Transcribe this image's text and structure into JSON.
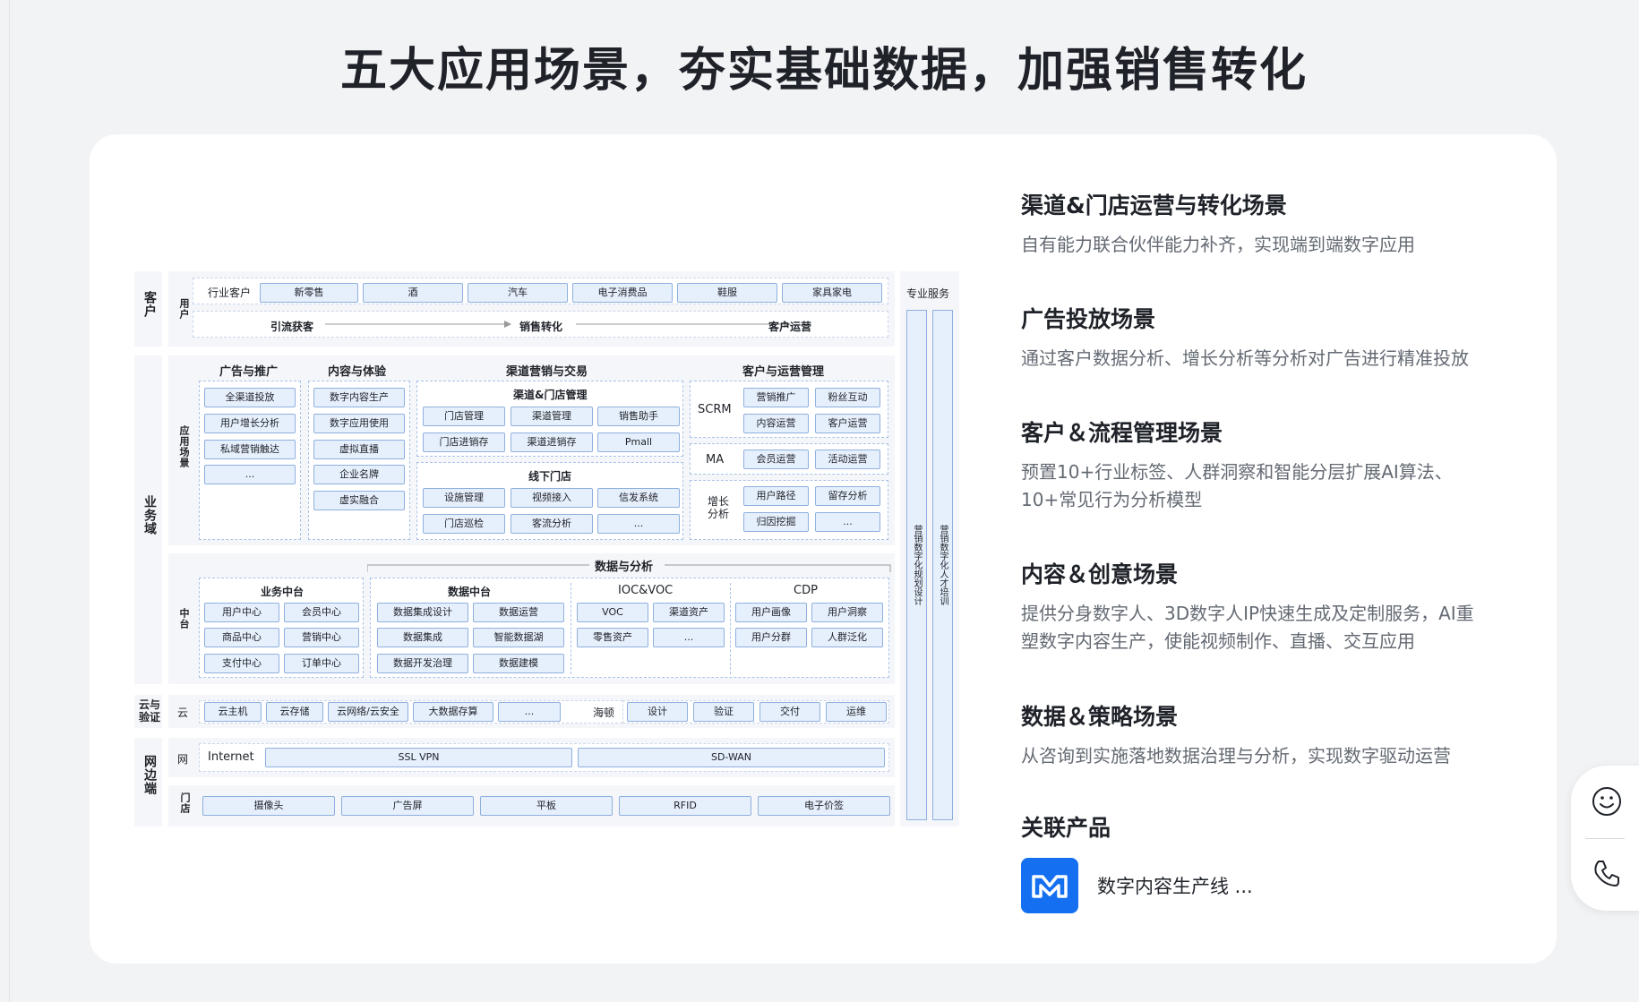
{
  "page": {
    "title": "五大应用场景，夯实基础数据，加强销售转化"
  },
  "diagram": {
    "customer_label": "客户",
    "user_label": "用户",
    "industry_label": "行业客户",
    "industries": [
      "新零售",
      "酒",
      "汽车",
      "电子消费品",
      "鞋服",
      "家具家电"
    ],
    "flow": [
      "引流获客",
      "销售转化",
      "客户运营"
    ],
    "business_label": "业务域",
    "app_label": "应用场景",
    "ad": {
      "title": "广告与推广",
      "items": [
        "全渠道投放",
        "用户增长分析",
        "私域营销触达",
        "..."
      ]
    },
    "content": {
      "title": "内容与体验",
      "items": [
        "数字内容生产",
        "数字应用使用",
        "虚拟直播",
        "企业名牌",
        "虚实融合"
      ]
    },
    "channel": {
      "title": "渠道营销与交易",
      "store_mgmt": {
        "title": "渠道&门店管理",
        "items": [
          "门店管理",
          "渠道管理",
          "销售助手",
          "门店进销存",
          "渠道进销存",
          "Pmall"
        ]
      },
      "offline": {
        "title": "线下门店",
        "items": [
          "设施管理",
          "视频接入",
          "信发系统",
          "门店巡检",
          "客流分析",
          "..."
        ]
      }
    },
    "ops": {
      "title": "客户与运营管理",
      "scrm_label": "SCRM",
      "scrm_items": [
        "营销推广",
        "粉丝互动",
        "内容运营",
        "客户运营"
      ],
      "ma_label": "MA",
      "ma_items": [
        "会员运营",
        "活动运营"
      ],
      "growth_label": "增长分析",
      "growth_items": [
        "用户路径",
        "留存分析",
        "归因挖掘",
        "..."
      ]
    },
    "data_analysis_title": "数据与分析",
    "middle_label": "中台",
    "biz_mid": {
      "title": "业务中台",
      "items": [
        "用户中心",
        "会员中心",
        "商品中心",
        "营销中心",
        "支付中心",
        "订单中心"
      ]
    },
    "data_mid": {
      "title": "数据中台",
      "items": [
        "数据集成设计",
        "数据运营",
        "数据集成",
        "智能数据湖",
        "数据开发治理",
        "数据建模"
      ]
    },
    "ioc": {
      "title": "IOC&VOC",
      "items": [
        "VOC",
        "渠道资产",
        "零售资产",
        "..."
      ]
    },
    "cdp": {
      "title": "CDP",
      "items": [
        "用户画像",
        "用户洞察",
        "用户分群",
        "人群泛化"
      ]
    },
    "cloud_label": "云与验证",
    "cloud_row_label": "云",
    "cloud_items": [
      "云主机",
      "云存储",
      "云网络/云安全",
      "大数据存算",
      "..."
    ],
    "haidun_label": "海顿",
    "haidun_items": [
      "设计",
      "验证",
      "交付",
      "运维"
    ],
    "edge_label": "网边端",
    "net_label": "网",
    "net_items": [
      "Internet",
      "SSL VPN",
      "SD-WAN"
    ],
    "store_label": "门店",
    "store_items": [
      "摄像头",
      "广告屏",
      "平板",
      "RFID",
      "电子价签"
    ],
    "pro_service": {
      "title": "专业服务",
      "bars": [
        "营销数字化规划设计",
        "营销数字化人才培训"
      ]
    }
  },
  "scenarios": [
    {
      "title": "渠道&门店运营与转化场景",
      "desc": "自有能力联合伙伴能力补齐，实现端到端数字应用"
    },
    {
      "title": "广告投放场景",
      "desc": "通过客户数据分析、增长分析等分析对广告进行精准投放"
    },
    {
      "title": "客户＆流程管理场景",
      "desc_lines": [
        "预置10+行业标签、人群洞察和智能分层扩展AI算法、",
        "10+常见行为分析模型"
      ]
    },
    {
      "title": "内容＆创意场景",
      "desc_lines": [
        "提供分身数字人、3D数字人IP快速生成及定制服务，AI重",
        "塑数字内容生产，使能视频制作、直播、交互应用"
      ]
    },
    {
      "title": "数据＆策略场景",
      "desc": "从咨询到实施落地数据治理与分析，实现数字驱动运营"
    }
  ],
  "related": {
    "title": "关联产品",
    "product_name": "数字内容生产线 ...",
    "icon": "digital-content-logo-icon",
    "brand_color": "#1470f0"
  },
  "floating": {
    "icons": [
      "smile-icon",
      "phone-icon"
    ]
  }
}
